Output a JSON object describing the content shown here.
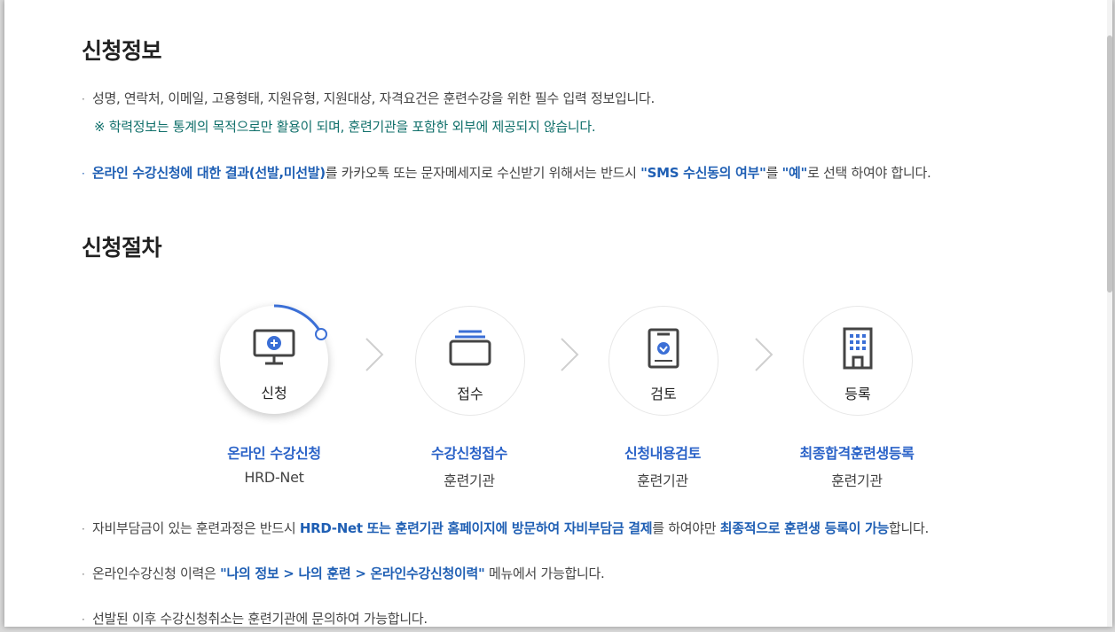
{
  "sections": {
    "info_title": "신청정보",
    "procedure_title": "신청절차"
  },
  "info": {
    "bullet1": "성명, 연락처, 이메일, 고용형태, 지원유형, 지원대상, 자격요건은 훈련수강을 위한 필수 입력 정보입니다.",
    "note": "※ 학력정보는 통계의 목적으로만 활용이 되며, 훈련기관을 포함한 외부에 제공되지 않습니다.",
    "bullet2": {
      "part1": "온라인 수강신청에 대한 결과(선발,미선발)",
      "part2": "를 카카오톡 또는 문자메세지로 수신받기 위해서는 반드시 ",
      "part3": "\"SMS 수신동의 여부\"",
      "part4": "를 ",
      "part5": "\"예\"",
      "part6": "로 선택 하여야 합니다."
    }
  },
  "steps": [
    {
      "label": "신청",
      "title": "온라인 수강신청",
      "subtitle": "HRD-Net",
      "icon": "monitor-plus-icon"
    },
    {
      "label": "접수",
      "title": "수강신청접수",
      "subtitle": "훈련기관",
      "icon": "tray-icon"
    },
    {
      "label": "검토",
      "title": "신청내용검토",
      "subtitle": "훈련기관",
      "icon": "clipboard-check-icon"
    },
    {
      "label": "등록",
      "title": "최종합격훈련생등록",
      "subtitle": "훈련기관",
      "icon": "building-icon"
    }
  ],
  "notes": {
    "n1": {
      "part1": "자비부담금이 있는 훈련과정은 반드시 ",
      "part2": "HRD-Net 또는 훈련기관 홈페이지에 방문하여 자비부담금 결제",
      "part3": "를 하여야만 ",
      "part4": "최종적으로 훈련생 등록이 가능",
      "part5": "합니다."
    },
    "n2": {
      "part1": "온라인수강신청 이력은 ",
      "part2": "\"나의 정보 > 나의 훈련 > 온라인수강신청이력\"",
      "part3": " 메뉴에서 가능합니다."
    },
    "n3": "선발된 이후 수강신청취소는 훈련기관에 문의하여 가능합니다."
  },
  "colors": {
    "accent_blue": "#2b63c8",
    "dark_blue": "#1f5fb4",
    "teal": "#0f6f6a"
  }
}
